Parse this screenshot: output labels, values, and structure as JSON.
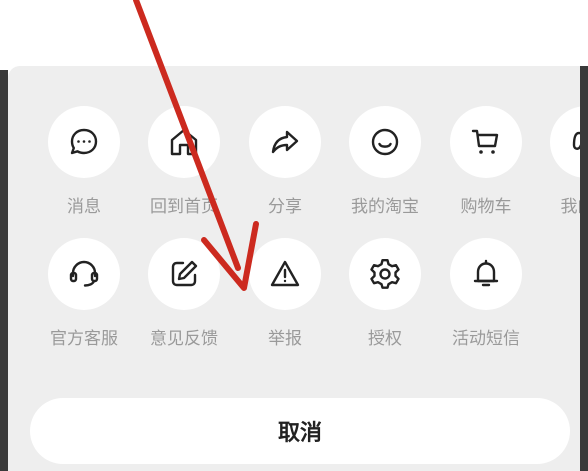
{
  "share_sheet": {
    "row1": [
      {
        "label": "消息",
        "icon": "message-icon"
      },
      {
        "label": "回到首页",
        "icon": "home-icon"
      },
      {
        "label": "分享",
        "icon": "share-icon"
      },
      {
        "label": "我的淘宝",
        "icon": "smiley-icon"
      },
      {
        "label": "购物车",
        "icon": "cart-icon"
      },
      {
        "label": "我的足",
        "icon": "footprint-icon"
      }
    ],
    "row2": [
      {
        "label": "官方客服",
        "icon": "headset-icon"
      },
      {
        "label": "意见反馈",
        "icon": "edit-icon"
      },
      {
        "label": "举报",
        "icon": "warning-icon"
      },
      {
        "label": "授权",
        "icon": "gear-icon"
      },
      {
        "label": "活动短信",
        "icon": "bell-icon"
      }
    ],
    "cancel_label": "取消"
  },
  "annotation": {
    "arrow_color": "#cc2a1f"
  }
}
